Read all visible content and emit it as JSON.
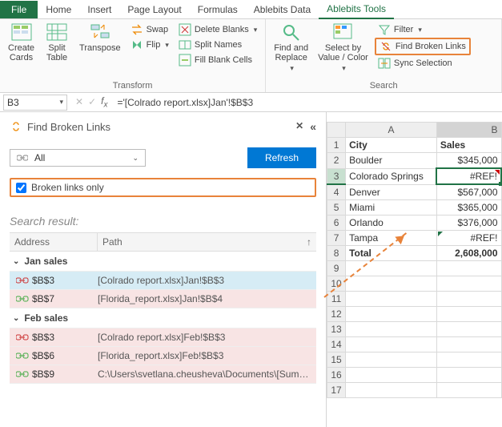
{
  "tabs": {
    "file": "File",
    "list": [
      "Home",
      "Insert",
      "Page Layout",
      "Formulas",
      "Ablebits Data",
      "Ablebits Tools"
    ]
  },
  "ribbon": {
    "transform": {
      "label": "Transform",
      "create_cards": "Create\nCards",
      "split_table": "Split\nTable",
      "transpose": "Transpose",
      "swap": "Swap",
      "flip": "Flip",
      "delete_blanks": "Delete Blanks",
      "split_names": "Split Names",
      "fill_blank": "Fill Blank Cells"
    },
    "search": {
      "label": "Search",
      "find_replace": "Find and\nReplace",
      "select_by": "Select by\nValue / Color",
      "filter": "Filter",
      "find_broken": "Find Broken Links",
      "sync_sel": "Sync Selection"
    }
  },
  "fx": {
    "name": "B3",
    "formula": "='[Colrado report.xlsx]Jan'!$B$3"
  },
  "pane": {
    "title": "Find Broken Links",
    "all": "All",
    "refresh": "Refresh",
    "check_label": "Broken links only",
    "result_label": "Search result:",
    "th_addr": "Address",
    "th_path": "Path",
    "groups": [
      {
        "name": "Jan sales",
        "rows": [
          {
            "addr": "$B$3",
            "path": "[Colrado report.xlsx]Jan!$B$3",
            "broken": true,
            "sel": true
          },
          {
            "addr": "$B$7",
            "path": "[Florida_report.xlsx]Jan!$B$4",
            "broken": false
          }
        ]
      },
      {
        "name": "Feb sales",
        "rows": [
          {
            "addr": "$B$3",
            "path": "[Colrado report.xlsx]Feb!$B$3",
            "broken": true
          },
          {
            "addr": "$B$6",
            "path": "[Florida_report.xlsx]Feb!$B$3",
            "broken": false
          },
          {
            "addr": "$B$9",
            "path": "C:\\Users\\svetlana.cheusheva\\Documents\\[Sum…",
            "broken": false
          }
        ]
      }
    ]
  },
  "grid": {
    "cols": [
      "A",
      "B"
    ],
    "header": {
      "A": "City",
      "B": "Sales"
    },
    "rows": [
      {
        "A": "Boulder",
        "B": "$345,000"
      },
      {
        "A": "Colorado Springs",
        "B": "#REF!",
        "sel": true,
        "redtri": true
      },
      {
        "A": "Denver",
        "B": "$567,000"
      },
      {
        "A": "Miami",
        "B": "$365,000"
      },
      {
        "A": "Orlando",
        "B": "$376,000"
      },
      {
        "A": "Tampa",
        "B": "#REF!",
        "greentri": true
      },
      {
        "A": "Total",
        "B": "2,608,000",
        "bold": true
      }
    ],
    "blank_rows": 9
  }
}
